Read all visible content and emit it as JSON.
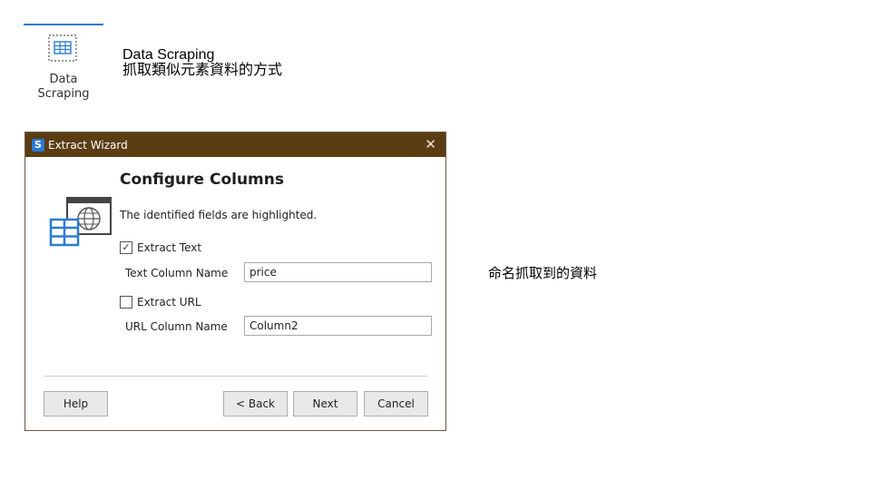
{
  "ribbon": {
    "button_label_line1": "Data",
    "button_label_line2": "Scraping",
    "description_title": "Data Scraping",
    "description_subtitle": "抓取類似元素資料的方式"
  },
  "side_note": "命名抓取到的資料",
  "dialog": {
    "title": "Extract Wizard",
    "heading": "Configure Columns",
    "subtext": "The identified fields are highlighted.",
    "extract_text": {
      "label": "Extract Text",
      "checked": true
    },
    "text_column": {
      "label": "Text Column Name",
      "value": "price"
    },
    "extract_url": {
      "label": "Extract URL",
      "checked": false
    },
    "url_column": {
      "label": "URL Column Name",
      "value": "Column2"
    },
    "buttons": {
      "help": "Help",
      "back": "< Back",
      "next": "Next",
      "cancel": "Cancel"
    }
  },
  "colors": {
    "titlebar": "#5b3d13",
    "accent_blue": "#2b7cd3"
  }
}
